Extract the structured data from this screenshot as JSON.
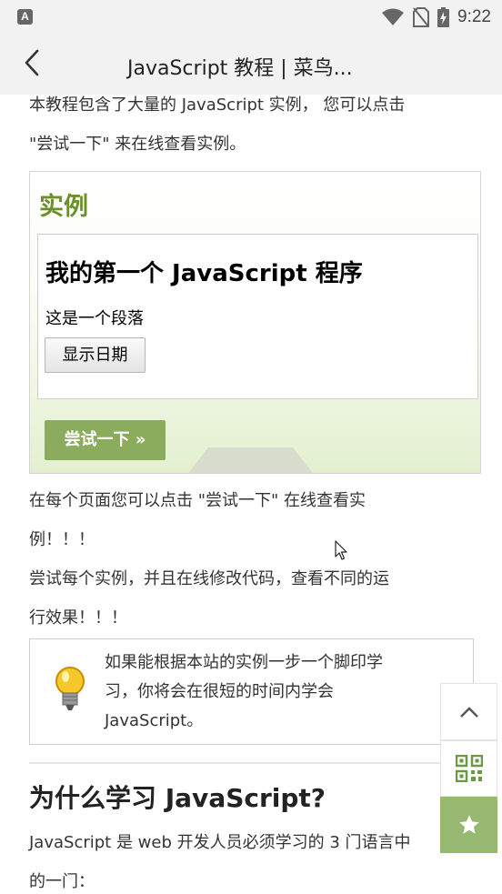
{
  "status_bar": {
    "time": "9:22",
    "app_icon_letter": "A",
    "icons": [
      "app-notification-icon",
      "wifi-icon",
      "no-sim-icon",
      "battery-charging-icon"
    ]
  },
  "app_bar": {
    "back_icon": "chevron-left-icon",
    "title": "JavaScript 教程 | 菜鸟..."
  },
  "content": {
    "intro_line1": "本教程包含了大量的 JavaScript 实例， 您可以点击",
    "intro_line2": "\"尝试一下\" 来在线查看实例。",
    "example": {
      "title": "实例",
      "demo_heading": "我的第一个 JavaScript 程序",
      "demo_paragraph": "这是一个段落",
      "demo_button": "显示日期",
      "try_button": "尝试一下 »"
    },
    "para2_line1": "在每个页面您可以点击 \"尝试一下\" 在线查看实",
    "para2_line2": "例！！！",
    "para3_line1": "尝试每个实例，并且在线修改代码，查看不同的运",
    "para3_line2": "行效果！！！",
    "tip": {
      "icon": "lightbulb-icon",
      "line1": "如果能根据本站的实例一步一个脚印学",
      "line2": "习，你将会在很短的时间内学会",
      "line3": "JavaScript。"
    },
    "section_title": "为什么学习 JavaScript?",
    "section_line1": "JavaScript 是 web 开发人员必须学习的 3 门语言中",
    "section_line2": "的一门："
  },
  "floating_buttons": [
    "back-to-top-icon",
    "qr-code-icon",
    "star-icon"
  ],
  "colors": {
    "accent_green": "#8aac5c",
    "example_title_green": "#6b8f2a",
    "bar_background": "#f2f2f2"
  }
}
